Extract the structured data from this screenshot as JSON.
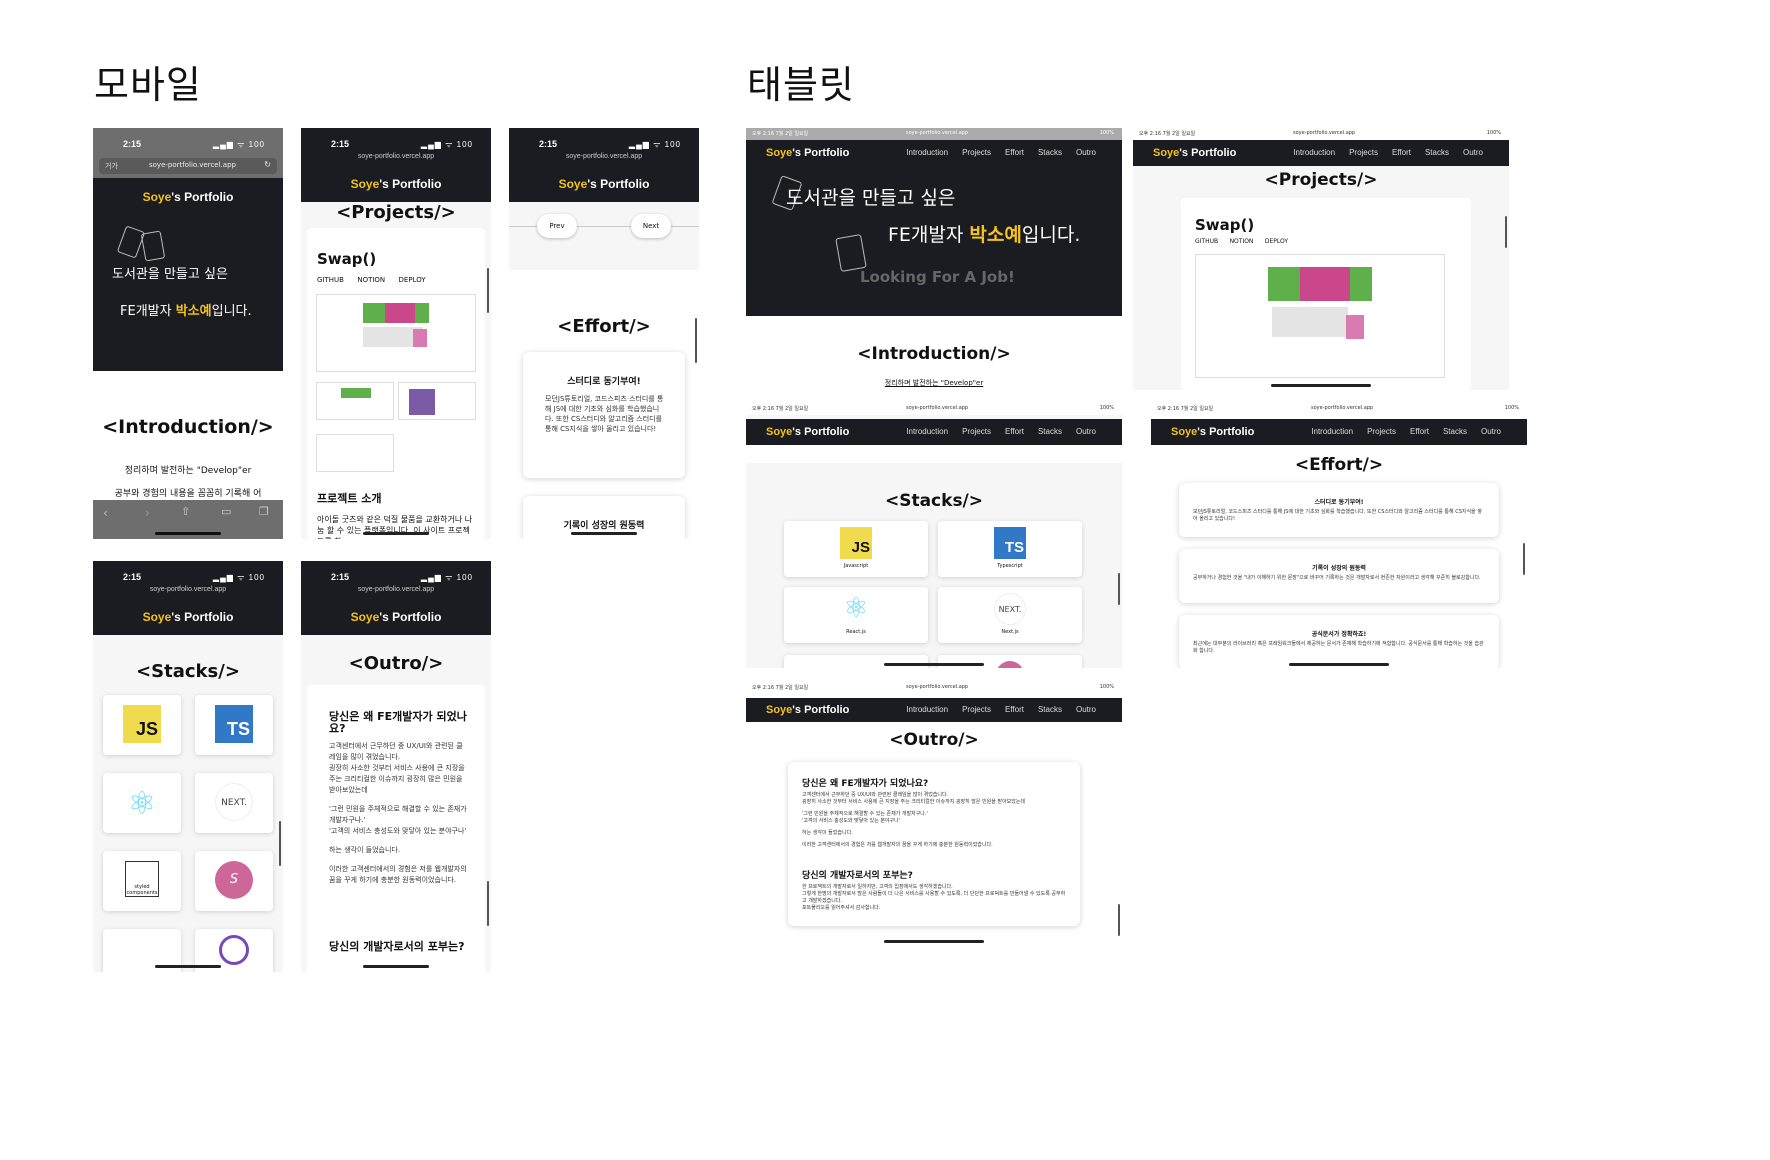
{
  "sections": {
    "mobile": "모바일",
    "tablet": "태블릿"
  },
  "status": {
    "time": "2:15",
    "icons": "▂▄▆ ᯤ 100",
    "tablet_time": "오후 2:16  7월 2일 일요일",
    "tablet_icons": "100%"
  },
  "url": "soye-portfolio.vercel.app",
  "browser_back_label": "거가",
  "brand": {
    "name_accent": "Soye",
    "name_rest": "'s Portfolio"
  },
  "nav": [
    "Introduction",
    "Projects",
    "Effort",
    "Stacks",
    "Outro"
  ],
  "hero": {
    "line1": "도서관을 만들고 싶은",
    "line2_pre": "FE개발자 ",
    "line2_name": "박소예",
    "line2_post": "입니다.",
    "tablet_line3": "Looking For A Job!"
  },
  "intro": {
    "title": "<Introduction/>",
    "subtitle": "정리하며 발전하는 \"Develop\"er",
    "body": "공부와 경험의 내용을 꼼꼼히 기록해 어"
  },
  "projects": {
    "title": "<Projects/>",
    "project_name": "Swap()",
    "links": [
      "GITHUB",
      "NOTION",
      "DEPLOY"
    ],
    "section_heading": "프로젝트 소개",
    "section_body": "아이돌 굿즈와 같은 덕질 물품을 교환하거나 나눔 할 수 있는 플랫폼입니다. 이 사이트 프로젝트를 하"
  },
  "pager": {
    "prev": "Prev",
    "next": "Next"
  },
  "effort": {
    "title": "<Effort/>",
    "cards": [
      {
        "heading": "스터디로 동기부여!",
        "body": "모던JS튜토리얼, 코드스피츠 스터디를 통해 JS에 대한 기초와 심화를 학습했습니다. 또한 CS스터디와 알고리즘 스터디를 통해 CS지식을 쌓아 올리고 있습니다!"
      },
      {
        "heading": "기록이 성장의 원동력",
        "body": "공부하거나 경험한 것을 \"내가 이해하기 위한 문장\"으로 바꾸어 기록하는 것은 개발자로서 현존한 자원이라고 생각해 꾸준히 블로깅합니다."
      },
      {
        "heading": "공식문서가 정확하죠!",
        "body": "최근에는 대부분의 라이브러리 혹은 프레임워크들에서 제공하는 문서가 존재해 학습하기에 적합합니다. 공식문서를 통해 학습하는 것을 습관화 합니다."
      }
    ]
  },
  "stacks": {
    "title": "<Stacks/>",
    "items": [
      {
        "icon": "JS",
        "label": "Javascript"
      },
      {
        "icon": "TS",
        "label": "Typescript"
      },
      {
        "icon": "⚛",
        "label": "React.js"
      },
      {
        "icon": "NEXT.",
        "label": "Next.js"
      }
    ],
    "styled_label": "styled components"
  },
  "outro": {
    "title": "<Outro/>",
    "q1": "당신은 왜 FE개발자가 되었나요?",
    "q1_body": [
      "고객센터에서 근무하던 중 UX/UI와 관련된 클레임을 많이 겪었습니다.",
      "굉장히 사소한 것부터 서비스 사용에 큰 지장을 주는 크리티컬한 이슈까지 굉장히 많은 민원을 받아보았는데",
      "'그런 민원을 주체적으로 해결할 수 있는 존재가 개발자구나.'",
      "'고객의 서비스 충성도와 맞닿아 있는 분야구나'",
      "하는 생각이 들었습니다.",
      "이러한 고객센터에서의 경험은 저를 웹개발자의 꿈을 꾸게 하기에 충분한 원동력이었습니다."
    ],
    "q2": "당신의 개발자로서의 포부는?",
    "q2_body": [
      "한 프로젝트의 개발자로서 일하지만, 고객의 입장에서도 생각하겠습니다.",
      "그렇게 한명의 개발자로서 많은 사람들이 더 나은 서비스를 사용할 수 있도록, 더 단단한 프로덕트를 만들어낼 수 있도록 공부하고 개발하겠습니다.",
      "포트폴리오를 읽어주셔서 감사합니다."
    ]
  },
  "colors": {
    "navbar": "#1b1c22",
    "accent": "#f3c31c",
    "js": "#f0db4f",
    "ts": "#3178c6"
  }
}
